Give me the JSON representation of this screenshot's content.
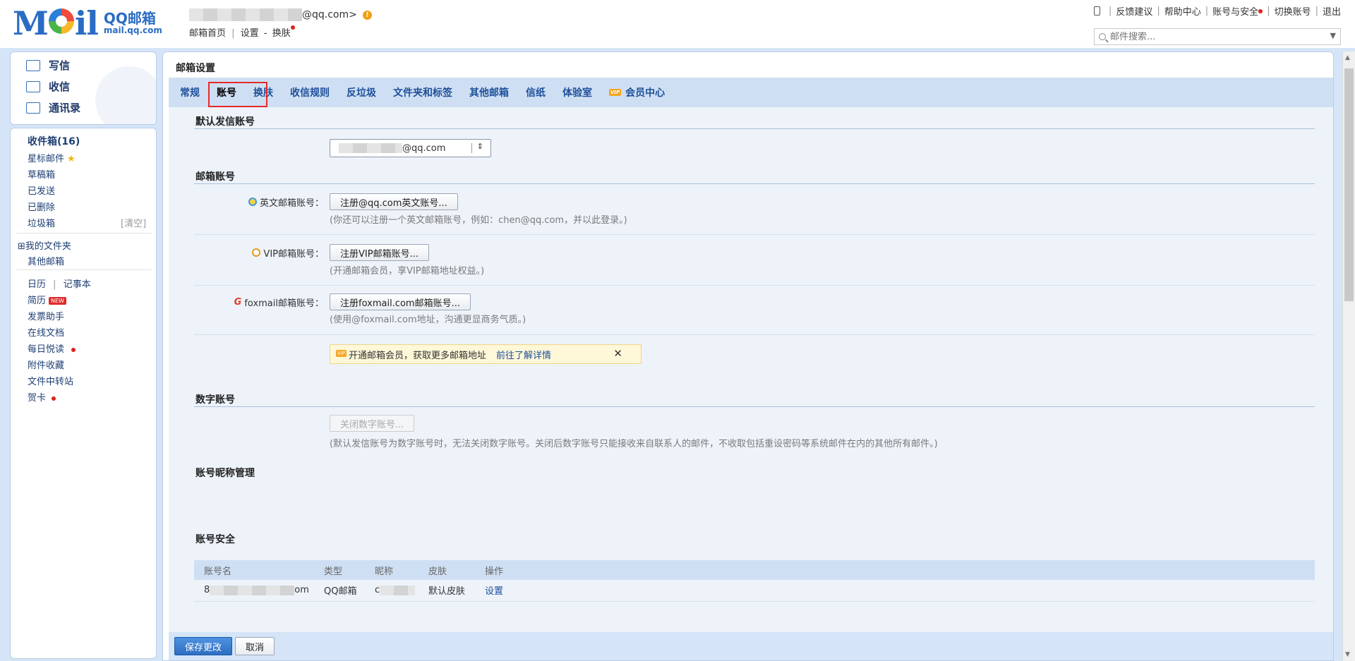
{
  "header": {
    "logo_text": "M",
    "logo_text_end": "il",
    "logo_cn": "QQ邮箱",
    "logo_domain": "mail.qq.com",
    "user_email": "@qq.com>",
    "warn_icon": "!",
    "links": [
      "邮箱首页",
      "设置",
      "换肤"
    ],
    "link_sep": "|",
    "link_dash": "-",
    "top_links": [
      "反馈建议",
      "帮助中心",
      "账号与安全",
      "切换账号",
      "退出"
    ],
    "search_placeholder": "邮件搜索..."
  },
  "sidebar": {
    "compose": [
      {
        "label": "写信",
        "icon": "compose-icon"
      },
      {
        "label": "收信",
        "icon": "inbox-icon"
      },
      {
        "label": "通讯录",
        "icon": "contacts-icon"
      }
    ],
    "inbox": "收件箱(16)",
    "starred": "星标邮件",
    "drafts": "草稿箱",
    "sent": "已发送",
    "deleted": "已删除",
    "trash": "垃圾箱",
    "trash_action": "[清空]",
    "my_folders": "⊞我的文件夹",
    "other_mail": "其他邮箱",
    "calendar": "日历",
    "calendar_sep": "|",
    "notes": "记事本",
    "resume": "简历",
    "new_badge": "NEW",
    "invoice": "发票助手",
    "docs": "在线文档",
    "daily": "每日悦读",
    "attachments": "附件收藏",
    "transfer": "文件中转站",
    "cards": "贺卡"
  },
  "main": {
    "title": "邮箱设置",
    "tabs": [
      "常规",
      "账号",
      "换肤",
      "收信规则",
      "反垃圾",
      "文件夹和标签",
      "其他邮箱",
      "信纸",
      "体验室",
      "会员中心"
    ],
    "vip_badge": "VIP",
    "sec_default": "默认发信账号",
    "default_select_value": "@qq.com",
    "sec_mail_accounts": "邮箱账号",
    "english_label": "英文邮箱账号：",
    "english_button": "注册@qq.com英文账号...",
    "english_hint": "(你还可以注册一个英文邮箱账号，例如：chen@qq.com，并以此登录。)",
    "vip_label": "VIP邮箱账号：",
    "vip_button": "注册VIP邮箱账号...",
    "vip_hint": "(开通邮箱会员，享VIP邮箱地址权益。)",
    "foxmail_label": "foxmail邮箱账号：",
    "foxmail_button": "注册foxmail.com邮箱账号...",
    "foxmail_hint": "(使用@foxmail.com地址，沟通更显商务气质。)",
    "banner_text": "开通邮箱会员，获取更多邮箱地址",
    "banner_link": "前往了解详情",
    "banner_close": "✕",
    "sec_numeric": "数字账号",
    "numeric_button": "关闭数字账号...",
    "numeric_hint": "(默认发信账号为数字账号时，无法关闭数字账号。关闭后数字账号只能接收来自联系人的邮件，不收取包括重设密码等系统邮件在内的其他所有邮件。)",
    "sec_nickname": "账号昵称管理",
    "table_headers": [
      "账号名",
      "类型",
      "昵称",
      "皮肤",
      "操作"
    ],
    "table_row": {
      "account_suffix": "om",
      "account_prefix": "8",
      "type": "QQ邮箱",
      "nickname_prefix": "c",
      "skin": "默认皮肤",
      "action": "设置"
    },
    "sec_security": "账号安全",
    "save_button": "保存更改",
    "cancel_button": "取消"
  },
  "colors": {
    "accent": "#2a6cc4",
    "frame": "#d5e5f7",
    "highlight": "#e52a2a"
  }
}
